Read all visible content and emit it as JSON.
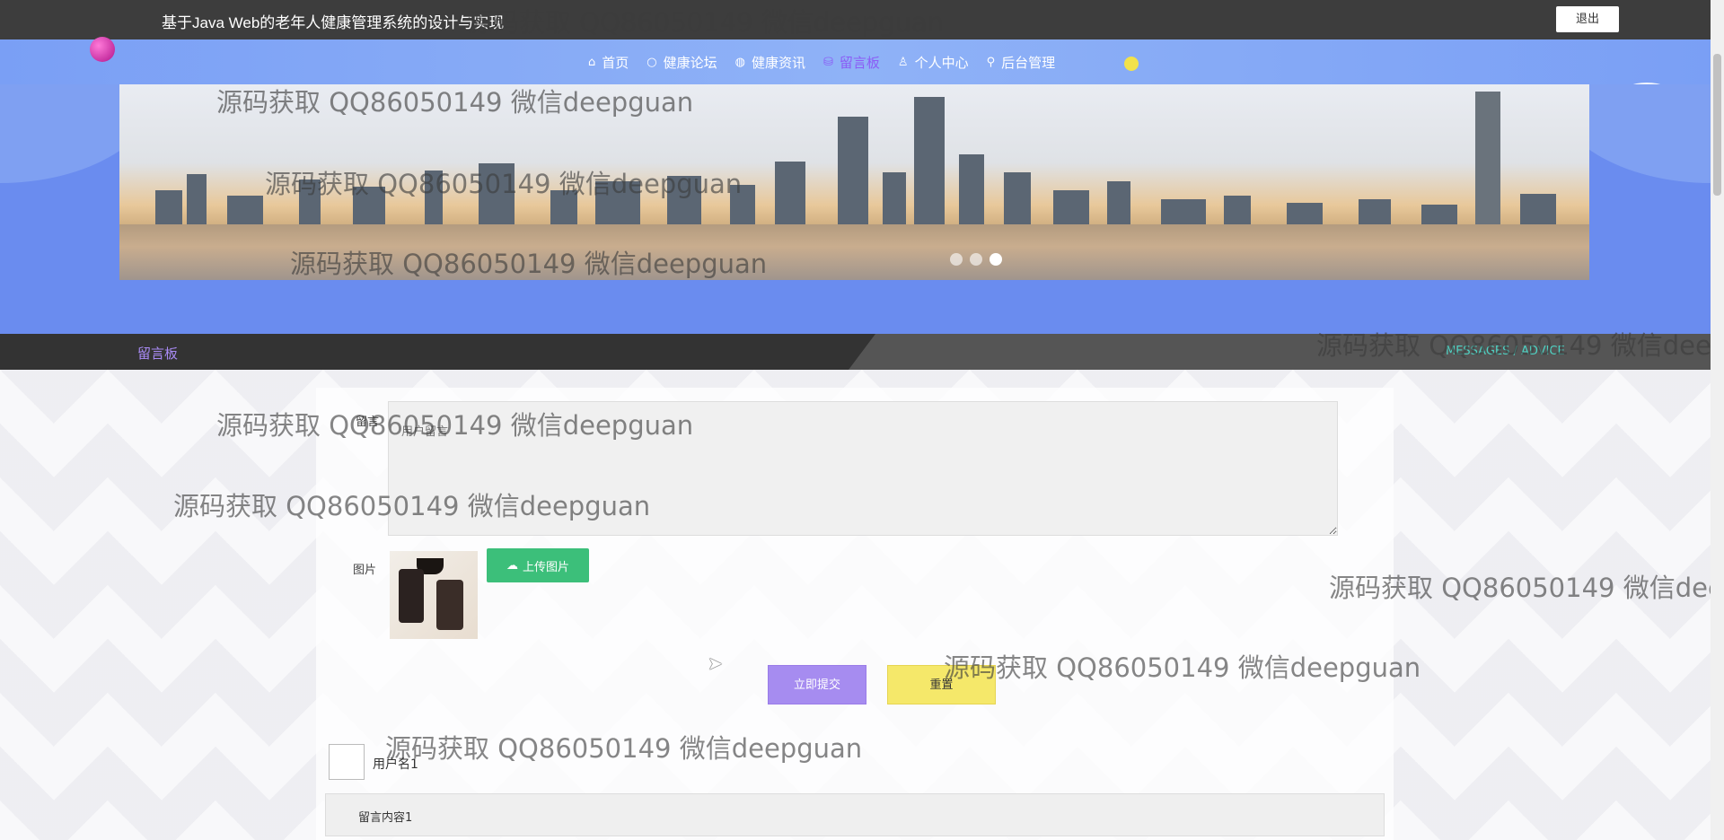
{
  "app": {
    "title": "基于Java Web的老年人健康管理系统的设计与实现",
    "logout_label": "退出"
  },
  "nav": {
    "items": [
      {
        "label": "首页",
        "icon": "home-icon"
      },
      {
        "label": "健康论坛",
        "icon": "circle-icon"
      },
      {
        "label": "健康资讯",
        "icon": "globe-icon"
      },
      {
        "label": "留言板",
        "icon": "database-icon",
        "active": true
      },
      {
        "label": "个人中心",
        "icon": "user-icon"
      },
      {
        "label": "后台管理",
        "icon": "link-icon"
      }
    ]
  },
  "banner": {
    "slide_count": 3,
    "active_slide": 3
  },
  "breadcrumb": {
    "label": "留言板",
    "english": "MESSAGES / ADVICE"
  },
  "form": {
    "message_label": "留言",
    "message_placeholder": "用户留言",
    "image_label": "图片",
    "upload_label": "上传图片",
    "submit_label": "立即提交",
    "reset_label": "重置"
  },
  "messages": [
    {
      "username": "用户名1",
      "content": "留言内容1"
    }
  ],
  "watermark": "源码获取 QQ86050149 微信deepguan",
  "colors": {
    "topbar": "#3d3d3d",
    "nav": "#8fb2f7",
    "active_nav": "#8b5cf6",
    "upload": "#3cbf7a",
    "submit": "#a68cf0",
    "reset": "#f5e86a"
  }
}
